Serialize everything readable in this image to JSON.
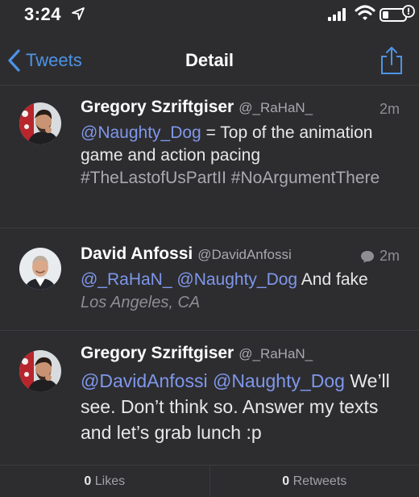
{
  "status_bar": {
    "time": "3:24",
    "icons": [
      "location-arrow-icon",
      "signal-icon",
      "wifi-icon",
      "battery-icon"
    ]
  },
  "nav": {
    "back_label": "Tweets",
    "title": "Detail",
    "share_icon": "share-icon"
  },
  "tweets": [
    {
      "name": "Gregory Szriftgiser",
      "handle": "@_RaHaN_",
      "time": "2m",
      "text": [
        {
          "type": "mention",
          "text": "@Naughty_Dog"
        },
        {
          "type": "text",
          "text": " = Top of the animation game and action pacing "
        },
        {
          "type": "hashtag",
          "text": "#TheLastofUsPartII"
        },
        {
          "type": "text",
          "text": " "
        },
        {
          "type": "hashtag",
          "text": "#NoArgumentThere"
        }
      ]
    },
    {
      "name": "David Anfossi",
      "handle": "@DavidAnfossi",
      "time": "2m",
      "time_icon": "reply-bubble-icon",
      "text": [
        {
          "type": "mention",
          "text": "@_RaHaN_"
        },
        {
          "type": "text",
          "text": " "
        },
        {
          "type": "mention",
          "text": "@Naughty_Dog"
        },
        {
          "type": "text",
          "text": " And fake"
        }
      ],
      "location": "Los Angeles, CA"
    },
    {
      "name": "Gregory Szriftgiser",
      "handle": "@_RaHaN_",
      "text": [
        {
          "type": "mention",
          "text": "@DavidAnfossi"
        },
        {
          "type": "text",
          "text": " "
        },
        {
          "type": "mention",
          "text": "@Naughty_Dog"
        },
        {
          "type": "text",
          "text": " We’ll see. Don’t think so. Answer my texts and let’s grab lunch :p"
        }
      ]
    }
  ],
  "stats": {
    "likes_count": "0",
    "likes_label": "Likes",
    "retweets_count": "0",
    "retweets_label": "Retweets"
  },
  "colors": {
    "background": "#2d2d30",
    "accent": "#4e93e6",
    "mention": "#7f97ea",
    "secondary_text": "#8e8e93"
  }
}
